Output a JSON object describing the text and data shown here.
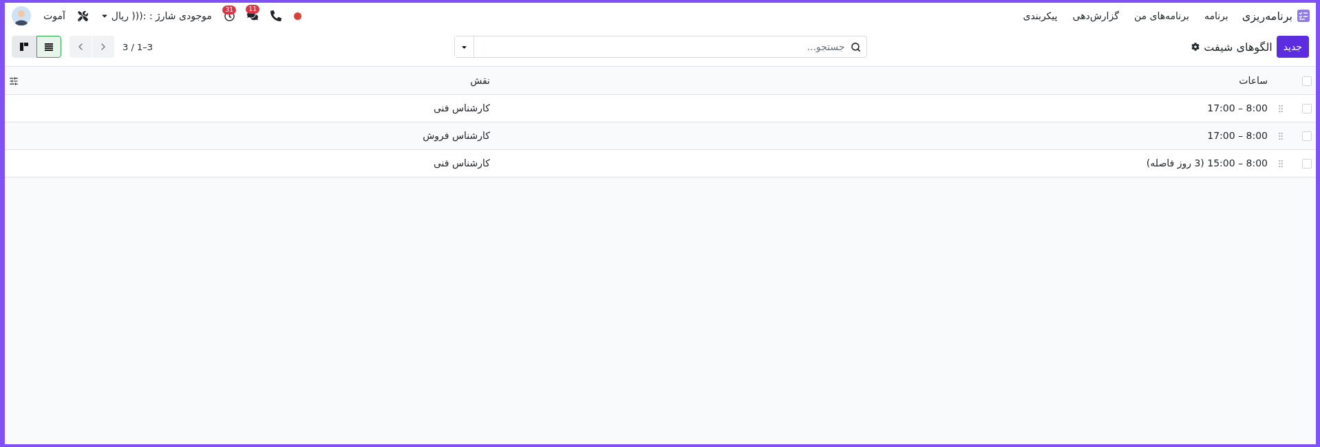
{
  "navbar": {
    "app_name": "برنامه‌ریزی",
    "menu": [
      "برنامه",
      "برنامه‌های من",
      "گزارش‌دهی",
      "پیکربندی"
    ],
    "chat_badge": "11",
    "activity_badge": "31",
    "balance": "موجودی شارژ : :((( ریال",
    "company": "آموت"
  },
  "control_panel": {
    "new_button": "جدید",
    "title": "الگوهای شیفت",
    "search_placeholder": "جستجو...",
    "pager": "3 / 1–3",
    "views": [
      {
        "kind": "list",
        "selected": true
      },
      {
        "kind": "kanban",
        "selected": false
      }
    ]
  },
  "table": {
    "columns": [
      "ساعات",
      "نقش"
    ],
    "header_checked": false,
    "rows": [
      {
        "hours": "8:00 – 17:00",
        "role": "کارشناس فنی",
        "checked": false
      },
      {
        "hours": "8:00 – 17:00",
        "role": "کارشناس فروش",
        "checked": false
      },
      {
        "hours": "8:00 – 15:00 (3 روز فاصله)",
        "role": "کارشناس فنی",
        "checked": false
      }
    ]
  }
}
